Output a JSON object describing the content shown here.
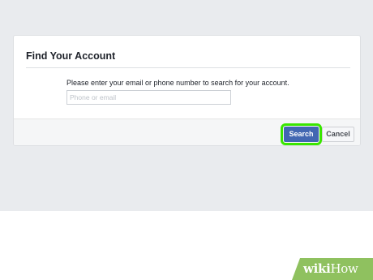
{
  "dialog": {
    "title": "Find Your Account",
    "prompt": "Please enter your email or phone number to search for your account.",
    "search_input": {
      "value": "",
      "placeholder": "Phone or email"
    },
    "search_button_label": "Search",
    "cancel_button_label": "Cancel"
  },
  "watermark": {
    "text_a": "wiki",
    "text_b": "How"
  },
  "colors": {
    "background": "#e9ebee",
    "primary_button": "#4267b2",
    "highlight": "#39e600",
    "watermark": "#8fc15f"
  }
}
